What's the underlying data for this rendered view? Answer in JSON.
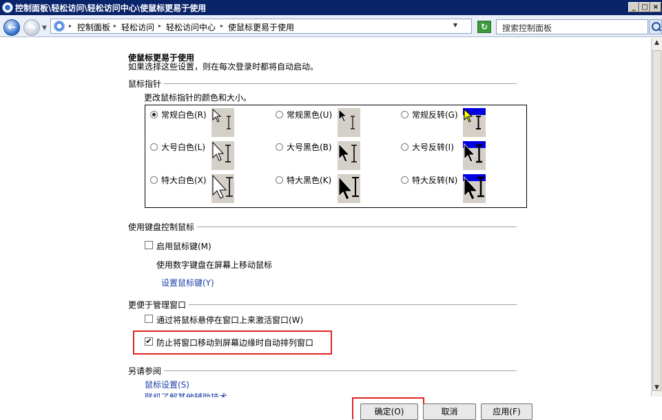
{
  "window": {
    "title": "控制面板\\轻松访问\\轻松访问中心\\使鼠标更易于使用"
  },
  "nav": {
    "breadcrumbs": [
      "控制面板",
      "轻松访问",
      "轻松访问中心",
      "使鼠标更易于使用"
    ],
    "search_placeholder": "搜索控制面板"
  },
  "page": {
    "title": "使鼠标更易于使用",
    "subtitle": "如果选择这些设置，则在每次登录时都将自动启动。"
  },
  "pointer_section": {
    "header": "鼠标指针",
    "desc": "更改鼠标指针的颜色和大小。",
    "options": [
      {
        "label": "常规白色(R)",
        "selected": true,
        "color": "white",
        "size": "regular"
      },
      {
        "label": "常规黑色(U)",
        "selected": false,
        "color": "black",
        "size": "regular"
      },
      {
        "label": "常规反转(G)",
        "selected": false,
        "color": "inverted",
        "size": "regular"
      },
      {
        "label": "大号白色(L)",
        "selected": false,
        "color": "white",
        "size": "large"
      },
      {
        "label": "大号黑色(B)",
        "selected": false,
        "color": "black",
        "size": "large"
      },
      {
        "label": "大号反转(I)",
        "selected": false,
        "color": "inverted",
        "size": "large"
      },
      {
        "label": "特大白色(X)",
        "selected": false,
        "color": "white",
        "size": "extra-large"
      },
      {
        "label": "特大黑色(K)",
        "selected": false,
        "color": "black",
        "size": "extra-large"
      },
      {
        "label": "特大反转(N)",
        "selected": false,
        "color": "inverted",
        "size": "extra-large"
      }
    ]
  },
  "keyboard_section": {
    "header": "使用键盘控制鼠标",
    "mousekeys_label": "启用鼠标键(M)",
    "mousekeys_checked": false,
    "mousekeys_desc": "使用数字键盘在屏幕上移动鼠标",
    "setup_link": "设置鼠标键(Y)"
  },
  "window_section": {
    "header": "更便于管理窗口",
    "hover_label": "通过将鼠标悬停在窗口上来激活窗口(W)",
    "hover_checked": false,
    "snap_label": "防止将窗口移动到屏幕边缘时自动排列窗口",
    "snap_checked": true
  },
  "see_also": {
    "header": "另请参阅",
    "links": [
      "鼠标设置(S)",
      "联机了解其他辅助技术"
    ]
  },
  "buttons": {
    "ok": "确定(O)",
    "cancel": "取消",
    "apply": "应用(F)"
  },
  "icons": {
    "check": "✔"
  },
  "colors": {
    "title_bar": "#0a246a",
    "highlight_box": "#e02020",
    "link": "#1b3ca7"
  }
}
